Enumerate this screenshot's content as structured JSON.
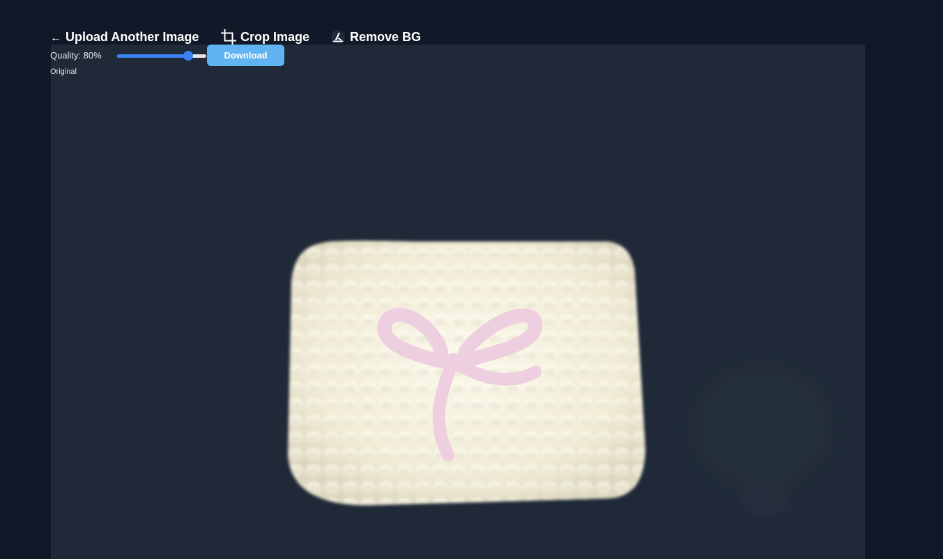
{
  "toolbar": {
    "upload": {
      "icon": "arrow-left-icon",
      "glyph": "←",
      "label": "Upload Another Image"
    },
    "crop": {
      "icon": "crop-icon",
      "label": "Crop Image"
    },
    "remove_bg": {
      "icon": "eraser-icon",
      "label": "Remove BG"
    }
  },
  "quality": {
    "label": "Quality: 80%",
    "value": 0.8
  },
  "download": {
    "label": "Download"
  },
  "preview": {
    "label": "Original"
  },
  "colors": {
    "page_bg": "#111827",
    "canvas_bg": "#1f2937",
    "accent": "#3b82f6",
    "download_bg": "#60b4f2"
  }
}
